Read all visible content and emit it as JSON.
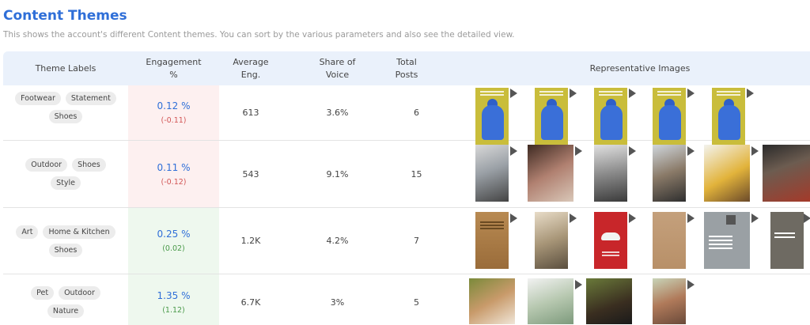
{
  "header": {
    "title": "Content Themes",
    "subtitle": "This shows the account's different Content themes. You can sort by the various parameters and also see the detailed view."
  },
  "columns": {
    "theme_labels": "Theme Labels",
    "engagement_l1": "Engagement",
    "engagement_l2": "%",
    "avg_l1": "Average",
    "avg_l2": "Eng.",
    "sov_l1": "Share of",
    "sov_l2": "Voice",
    "posts_l1": "Total",
    "posts_l2": "Posts",
    "images": "Representative Images"
  },
  "rows": [
    {
      "tags": [
        "Footwear",
        "Statement",
        "Shoes"
      ],
      "engagement": "0.12 %",
      "delta": "(-0.11)",
      "delta_sign": "neg",
      "avg": "613",
      "sov": "3.6%",
      "posts": "6",
      "image_count": 5
    },
    {
      "tags": [
        "Outdoor",
        "Shoes",
        "Style"
      ],
      "engagement": "0.11 %",
      "delta": "(-0.12)",
      "delta_sign": "neg",
      "avg": "543",
      "sov": "9.1%",
      "posts": "15",
      "image_count": 6
    },
    {
      "tags": [
        "Art",
        "Home & Kitchen",
        "Shoes"
      ],
      "engagement": "0.25 %",
      "delta": "(0.02)",
      "delta_sign": "pos",
      "avg": "1.2K",
      "sov": "4.2%",
      "posts": "7",
      "image_count": 6
    },
    {
      "tags": [
        "Pet",
        "Outdoor",
        "Nature"
      ],
      "engagement": "1.35 %",
      "delta": "(1.12)",
      "delta_sign": "pos",
      "avg": "6.7K",
      "sov": "3%",
      "posts": "5",
      "image_count": 4
    }
  ],
  "colors": {
    "accent": "#2f6fd8",
    "header_bg": "#eaf1fb",
    "negative": "#d25555",
    "positive": "#4a9a4a"
  }
}
